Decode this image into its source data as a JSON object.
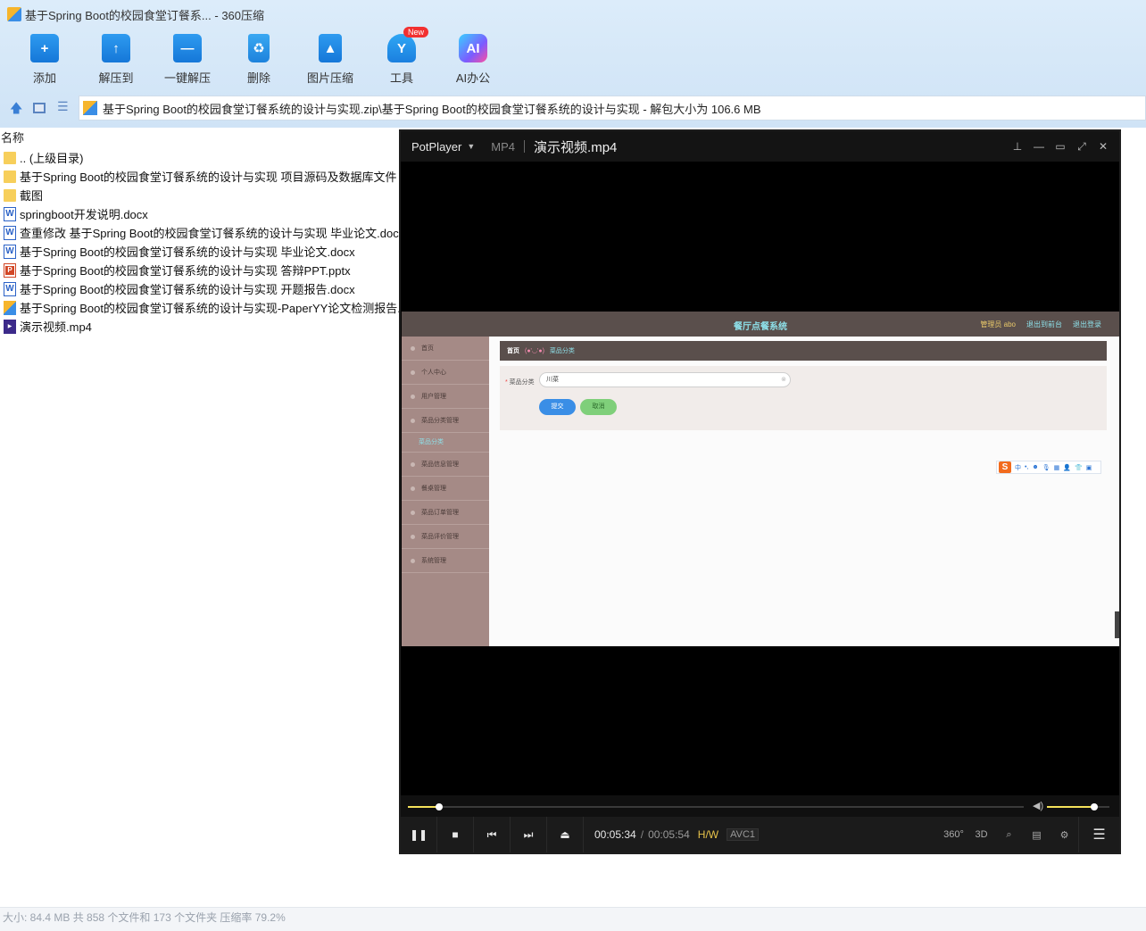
{
  "window": {
    "title": "基于Spring Boot的校园食堂订餐系... - 360压缩"
  },
  "toolbar": {
    "items": [
      {
        "label": "添加",
        "icon": "add-folder-icon"
      },
      {
        "label": "解压到",
        "icon": "extract-to-icon"
      },
      {
        "label": "一键解压",
        "icon": "one-click-extract-icon"
      },
      {
        "label": "删除",
        "icon": "trash-icon"
      },
      {
        "label": "图片压缩",
        "icon": "image-compress-icon"
      },
      {
        "label": "工具",
        "icon": "tools-icon",
        "badge": "New"
      },
      {
        "label": "AI办公",
        "icon": "ai-office-icon",
        "glyph": "AI"
      }
    ]
  },
  "path": {
    "text": "基于Spring Boot的校园食堂订餐系统的设计与实现.zip\\基于Spring Boot的校园食堂订餐系统的设计与实现 - 解包大小为 106.6 MB"
  },
  "filelist": {
    "column_name": "名称",
    "items": [
      {
        "name": ".. (上级目录)",
        "type": "folder"
      },
      {
        "name": "基于Spring Boot的校园食堂订餐系统的设计与实现 项目源码及数据库文件",
        "type": "folder"
      },
      {
        "name": "截图",
        "type": "folder"
      },
      {
        "name": "springboot开发说明.docx",
        "type": "doc"
      },
      {
        "name": "查重修改 基于Spring Boot的校园食堂订餐系统的设计与实现 毕业论文.docx",
        "type": "doc"
      },
      {
        "name": "基于Spring Boot的校园食堂订餐系统的设计与实现 毕业论文.docx",
        "type": "doc"
      },
      {
        "name": "基于Spring Boot的校园食堂订餐系统的设计与实现 答辩PPT.pptx",
        "type": "ppt"
      },
      {
        "name": "基于Spring Boot的校园食堂订餐系统的设计与实现 开题报告.docx",
        "type": "doc"
      },
      {
        "name": "基于Spring Boot的校园食堂订餐系统的设计与实现-PaperYY论文检测报告.zip",
        "type": "zip"
      },
      {
        "name": "演示视频.mp4",
        "type": "mp4"
      }
    ]
  },
  "status": {
    "text": "大小: 84.4 MB 共 858 个文件和 173 个文件夹 压缩率 79.2%"
  },
  "player": {
    "brand": "PotPlayer",
    "format": "MP4",
    "filename": "演示视频.mp4",
    "time_current": "00:05:34",
    "time_separator": "/",
    "time_total": "00:05:54",
    "hw": "H/W",
    "codec": "AVC1",
    "seek_progress": 0.05,
    "volume_level": 0.75,
    "right_buttons": [
      "360°",
      "3D"
    ],
    "video": {
      "app_title": "餐厅点餐系统",
      "admin": "管理员 abo",
      "link_backend": "退出到前台",
      "link_logout": "退出登录",
      "sidebar": [
        "首页",
        "个人中心",
        "用户管理",
        "菜品分类管理",
        "菜品分类",
        "菜品信息管理",
        "餐桌管理",
        "菜品订单管理",
        "菜品评价管理",
        "系统管理"
      ],
      "crumb_home": "首页",
      "crumb_emoji": "(●'◡'●)",
      "crumb_current": "菜品分类",
      "form_label": "菜品分类",
      "form_value": "川菜",
      "submit_label": "提交",
      "cancel_label": "取消",
      "ime_logo": "S",
      "ime_mode": "中"
    }
  }
}
